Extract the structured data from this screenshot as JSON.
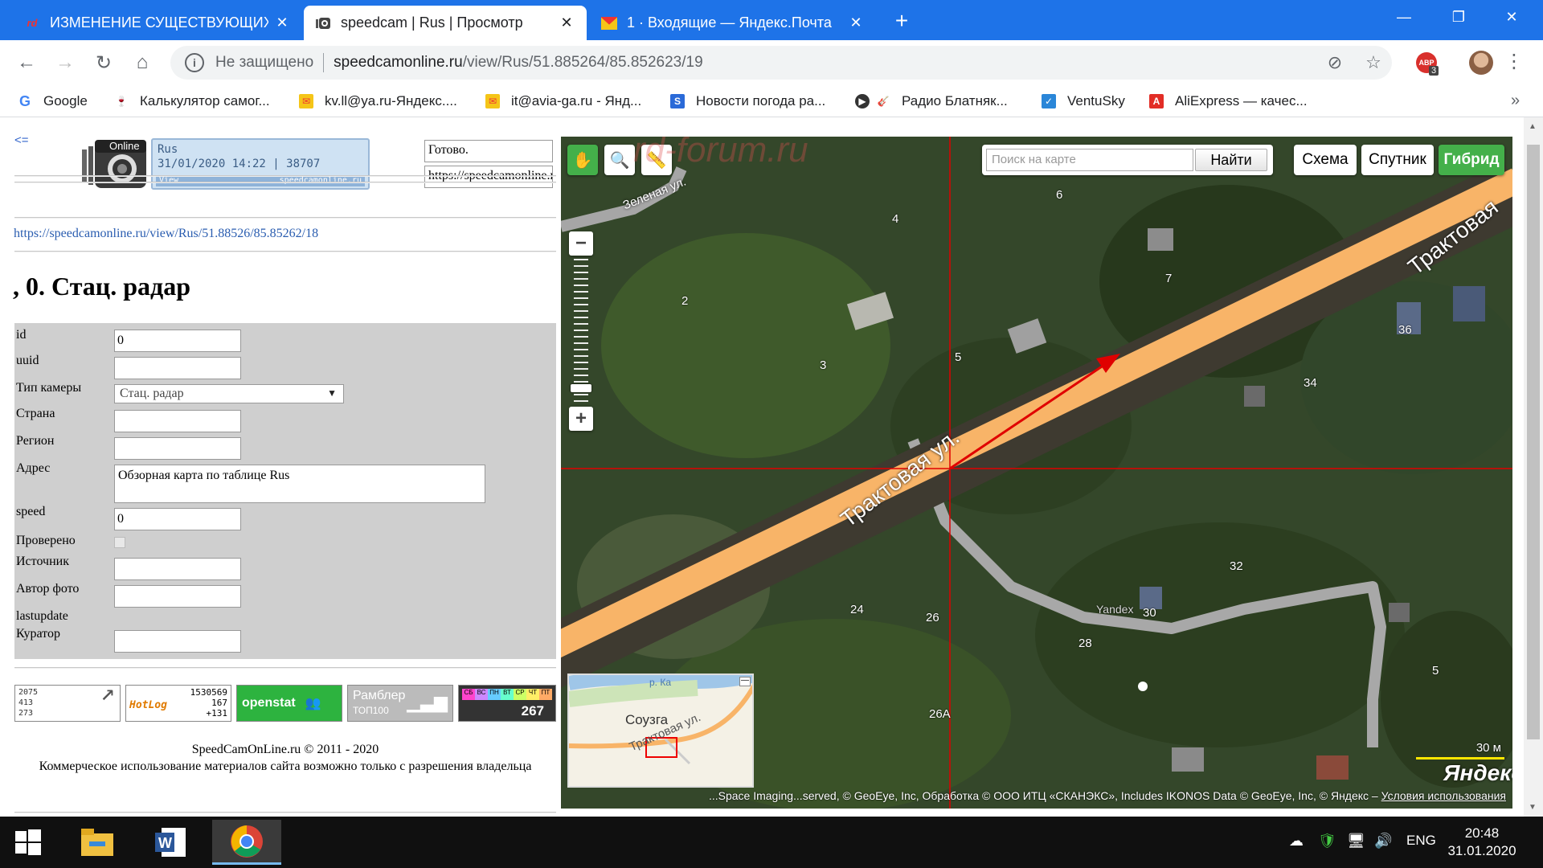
{
  "browser": {
    "tabs": [
      {
        "title": "ИЗМЕНЕНИЕ СУЩЕСТВУЮЩИХ",
        "icon": "rd-forum-icon"
      },
      {
        "title": "speedcam | Rus | Просмотр",
        "icon": "speedcam-icon"
      },
      {
        "title": "1 · Входящие — Яндекс.Почта",
        "icon": "mail-icon"
      }
    ],
    "omnibox": {
      "security": "Не защищено",
      "host": "speedcamonline.ru",
      "path": "/view/Rus/51.885264/85.852623/19"
    },
    "abp_count": "3",
    "abp_label": "ABP",
    "bookmarks": [
      {
        "label": "Google",
        "color": "#4285f4",
        "glyph": "G"
      },
      {
        "label": "Калькулятор самог...",
        "color": "#c8832a",
        "glyph": "🍷"
      },
      {
        "label": "kv.ll@ya.ru-Яндекс....",
        "color": "#e24a2a",
        "glyph": "✉"
      },
      {
        "label": "it@avia-ga.ru - Янд...",
        "color": "#e24a2a",
        "glyph": "✉"
      },
      {
        "label": "Новости погода ра...",
        "color": "#2a6ad8",
        "glyph": "S"
      },
      {
        "label": "Радио Блатняк...",
        "color": "#c23a2a",
        "glyph": "🎸"
      },
      {
        "label": "VentuSky",
        "color": "#2a86d8",
        "glyph": "✓"
      },
      {
        "label": "AliExpress — качес...",
        "color": "#e22d26",
        "glyph": "A"
      }
    ]
  },
  "page": {
    "back_link": "<=",
    "logo": {
      "line1": "Rus",
      "line2": "31/01/2020 14:22 | 38707",
      "bottom_left": "View",
      "bottom_right": "speedcamonline.ru",
      "brand": "Online"
    },
    "status_box": "Готово.",
    "url_box": "https://speedcamonline.ru",
    "link": "https://speedcamonline.ru/view/Rus/51.88526/85.85262/18",
    "title": ", 0. Стац. радар",
    "form": {
      "fields": [
        {
          "label": "id",
          "value": ""
        },
        {
          "label": "uuid",
          "value": ""
        },
        {
          "label": "Тип камеры",
          "value": "Стац. радар"
        },
        {
          "label": "Страна",
          "value": ""
        },
        {
          "label": "Регион",
          "value": ""
        },
        {
          "label": "Адрес",
          "value": "Обзорная карта по таблице Rus"
        },
        {
          "label": "speed",
          "value": "0"
        },
        {
          "label": "Проверено",
          "value": ""
        },
        {
          "label": "Источник",
          "value": ""
        },
        {
          "label": "Автор фото",
          "value": ""
        },
        {
          "label": "lastupdate",
          "value": ""
        },
        {
          "label": "Куратор",
          "value": ""
        }
      ],
      "id_value": "0"
    },
    "counters": {
      "c1": [
        "2075",
        "413",
        "273"
      ],
      "c2_label": "HotLog",
      "c2": [
        "1530569",
        "167",
        "+131"
      ],
      "c3": "openstat",
      "c4_top": "Рамблер",
      "c4_bottom": "ТОП100",
      "c5_days": [
        "СБ",
        "ВС",
        "ПН",
        "ВТ",
        "СР",
        "ЧТ",
        "ПТ"
      ],
      "c5_value": "267"
    },
    "footer_line1": "SpeedCamOnLine.ru © 2011 - 2020",
    "footer_line2": "Коммерческое использование материалов сайта возможно только с разрешения владельца"
  },
  "map": {
    "search_placeholder": "Поиск на карте",
    "search_button": "Найти",
    "types": [
      "Схема",
      "Спутник",
      "Гибрид"
    ],
    "active_type": "Гибрид",
    "street_main": "Трактовая ул.",
    "street_main_2": "Трактовая",
    "street_green": "Зеленая ул.",
    "house_numbers": [
      "6",
      "4",
      "7",
      "2",
      "3",
      "5",
      "36",
      "34",
      "32",
      "24",
      "26",
      "30",
      "28",
      "5",
      "26А"
    ],
    "yandex_watermark": "Yandex",
    "minimap_village": "Соузга",
    "minimap_street": "Трактовая ул.",
    "minimap_river": "р. Ка",
    "scale": "30 м",
    "logo": "Яндекс",
    "copyright_text": "...Space Imaging...served, © GeoEye, Inc, Обработка © ООО ИТЦ «СКАНЭКС», Includes IKONOS Data © GeoEye, Inc, © Яндекс – ",
    "copyright_link": "Условия использования",
    "watermark": "rd-forum.ru"
  },
  "taskbar": {
    "lang": "ENG",
    "time": "20:48",
    "date": "31.01.2020"
  },
  "colors": {
    "chrome_blue": "#1e73e8",
    "map_green": "#44b04a",
    "road_orange": "#f8b468",
    "crosshair_red": "#e00000"
  }
}
